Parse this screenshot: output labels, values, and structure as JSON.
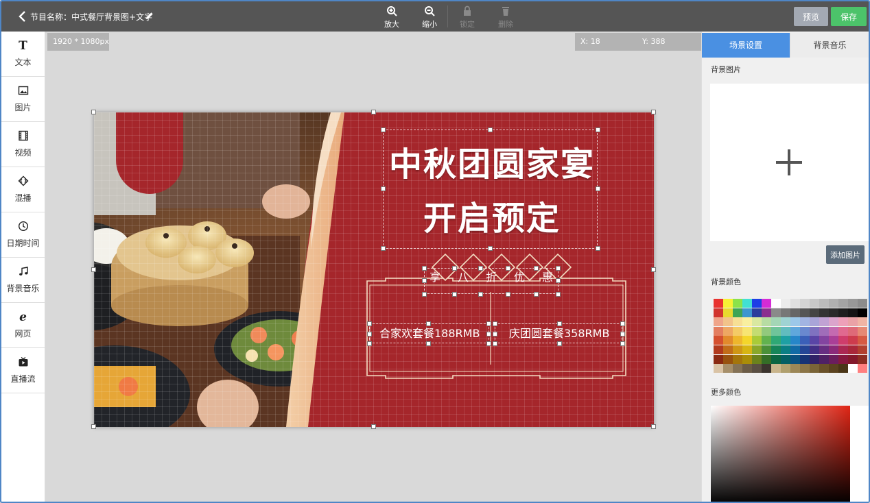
{
  "topbar": {
    "program_prefix": "节目名称：",
    "program_name": "中式餐厅背景图+文字",
    "zoom_in_label": "放大",
    "zoom_out_label": "缩小",
    "lock_label": "锁定",
    "delete_label": "删除",
    "preview_label": "预览",
    "save_label": "保存"
  },
  "sidebar": {
    "items": [
      {
        "label": "文本",
        "icon": "text-icon"
      },
      {
        "label": "图片",
        "icon": "image-icon"
      },
      {
        "label": "视频",
        "icon": "video-icon"
      },
      {
        "label": "混播",
        "icon": "mix-icon"
      },
      {
        "label": "日期时间",
        "icon": "clock-icon"
      },
      {
        "label": "背景音乐",
        "icon": "music-icon"
      },
      {
        "label": "网页",
        "icon": "ie-icon"
      },
      {
        "label": "直播流",
        "icon": "live-icon"
      }
    ]
  },
  "workspace": {
    "canvas_size": "1920 * 1080px",
    "x_readout": "X: 18",
    "y_readout": "Y: 388"
  },
  "canvas": {
    "title_line1": "中秋团圆家宴",
    "title_line2": "开启预定",
    "banner_chars": [
      "享",
      "八",
      "折",
      "优",
      "惠"
    ],
    "package1": "合家欢套餐188RMB",
    "package2": "庆团圆套餐358RMB"
  },
  "right_panel": {
    "tab_scene": "场景设置",
    "tab_music": "背景音乐",
    "bg_image_label": "背景图片",
    "add_image_label": "添加图片",
    "bg_color_label": "背景颜色",
    "more_colors_label": "更多颜色"
  },
  "colors": {
    "accent_blue": "#4a90e2",
    "save_green": "#4cc36a",
    "topbar_gray": "#555555",
    "poster_red": "#a5262b",
    "selected_swatch": "#ffffff"
  }
}
